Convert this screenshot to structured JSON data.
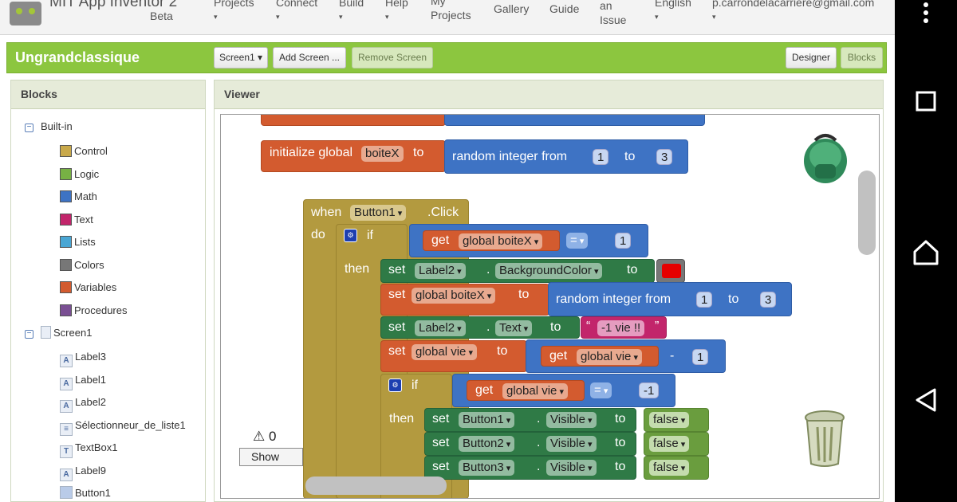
{
  "header": {
    "brand": "MIT App Inventor 2",
    "brand_sub": "Beta",
    "menus": [
      {
        "label": "Projects",
        "caret": "▾"
      },
      {
        "label": "Connect",
        "caret": "▾"
      },
      {
        "label": "Build",
        "caret": "▾"
      },
      {
        "label": "Help",
        "caret": "▾"
      },
      {
        "label": "My\nProjects",
        "caret": ""
      },
      {
        "label": "Gallery",
        "caret": ""
      },
      {
        "label": "Guide",
        "caret": ""
      },
      {
        "label": "an\nIssue",
        "caret": ""
      },
      {
        "label": "English",
        "caret": "▾"
      },
      {
        "label": "p.carrondelacarriere@gmail.com",
        "caret": "▾"
      }
    ]
  },
  "project": {
    "name": "Ungrandclassique",
    "screen_select": "Screen1 ▾",
    "add_screen": "Add Screen ...",
    "remove_screen": "Remove Screen",
    "designer": "Designer",
    "blocks": "Blocks"
  },
  "blocks_panel": {
    "title": "Blocks",
    "builtin_label": "Built-in",
    "builtin_items": [
      {
        "label": "Control",
        "color": "#c9a94a"
      },
      {
        "label": "Logic",
        "color": "#77b144"
      },
      {
        "label": "Math",
        "color": "#3e73c4"
      },
      {
        "label": "Text",
        "color": "#c2256b"
      },
      {
        "label": "Lists",
        "color": "#49a6d4"
      },
      {
        "label": "Colors",
        "color": "#777777"
      },
      {
        "label": "Variables",
        "color": "#d35b2f"
      },
      {
        "label": "Procedures",
        "color": "#7a4f93"
      }
    ],
    "screen_label": "Screen1",
    "components": [
      {
        "label": "Label3",
        "icon": "label-icon"
      },
      {
        "label": "Label1",
        "icon": "label-icon"
      },
      {
        "label": "Label2",
        "icon": "label-icon"
      },
      {
        "label": "Sélectionneur_de_liste1",
        "icon": "list-picker-icon"
      },
      {
        "label": "TextBox1",
        "icon": "textbox-icon"
      },
      {
        "label": "Label9",
        "icon": "label-icon"
      },
      {
        "label": "Button1",
        "icon": "button-icon"
      }
    ]
  },
  "viewer": {
    "title": "Viewer",
    "warnings_count": "0",
    "show_warnings": "Show Warnings",
    "init_block": {
      "keyword": "initialize global",
      "var": "boiteX",
      "to": "to",
      "rand": "random integer from",
      "from": "1",
      "to2": "to",
      "upto": "3"
    },
    "event_block": {
      "when": "when",
      "component": "Button1",
      "event": ".Click",
      "do": "do",
      "if": "if",
      "then": "then",
      "get_kw": "get",
      "boitex": "global boiteX",
      "eq": "=",
      "one": "1",
      "set_kw": "set",
      "label2": "Label2",
      "bgcolor": "BackgroundColor",
      "to": "to",
      "red": "#e60000",
      "rand": "random integer from",
      "three": "3",
      "text_prop": "Text",
      "vie_text": "-1 vie !!",
      "open_quote": "“",
      "close_quote": "”",
      "vie": "global vie",
      "minus": "-",
      "neg_one": "-1",
      "dot": ".",
      "button1": "Button1",
      "button2": "Button2",
      "button3": "Button3",
      "visible": "Visible",
      "false": "false"
    }
  }
}
